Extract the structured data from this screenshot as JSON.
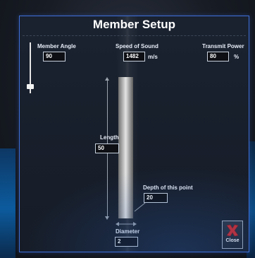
{
  "dialog": {
    "title": "Member Setup"
  },
  "fields": {
    "member_angle": {
      "label": "Member Angle",
      "value": "90"
    },
    "speed_of_sound": {
      "label": "Speed of Sound",
      "value": "1482",
      "unit": "m/s"
    },
    "transmit_power": {
      "label": "Transmit Power",
      "value": "80",
      "unit": "%"
    },
    "length": {
      "label": "Length",
      "value": "50"
    },
    "depth": {
      "label": "Depth of this point",
      "value": "20"
    },
    "diameter": {
      "label": "Diameter",
      "value": "2"
    }
  },
  "slider": {
    "name": "member-angle-slider"
  },
  "close_button": {
    "label": "Close",
    "icon": "close-x-icon",
    "color": "#d42a2a"
  },
  "colors": {
    "dialog_border": "#3e6fd8",
    "background": "#161c27"
  }
}
